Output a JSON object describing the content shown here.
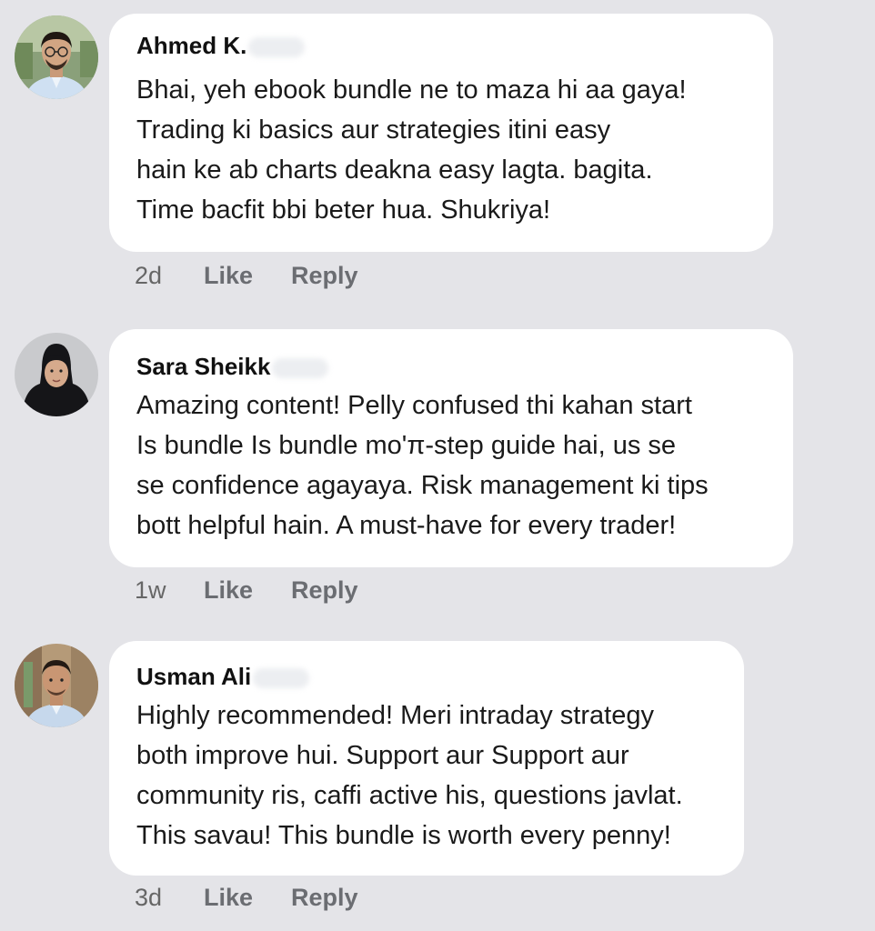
{
  "comments": [
    {
      "author": "Ahmed K.",
      "lines": [
        "Bhai, yeh ebook bundle ne to maza hi aa gaya!",
        "Trading ki basics aur strategies  itini easy",
        "hain ke ab charts deakna easy lagta.  bagita.",
        "Time bacfit bbi beter hua. Shukriya!"
      ],
      "time": "2d",
      "like": "Like",
      "reply": "Reply"
    },
    {
      "author": "Sara Sheikk",
      "lines": [
        "Amazing content! Pelly confused thi kahan start",
        "Is bundle Is bundle mo'π-step guide hai, us se",
        "se  confidence agayaya. Risk management ki tips",
        "bott helpful hain. A must-have for every trader!"
      ],
      "time": "1w",
      "like": "Like",
      "reply": "Reply"
    },
    {
      "author": "Usman Ali",
      "lines": [
        "Highly recommended! Meri intraday strategy",
        "both improve hui. Support aur Support aur",
        "community ris, caffi active his, questions javlat.",
        "This savau! This bundle is worth every penny!"
      ],
      "time": "3d",
      "like": "Like",
      "reply": "Reply"
    }
  ],
  "colors": {
    "background": "#e4e4e8",
    "bubble": "#ffffff",
    "meta_text": "#6b6d72"
  },
  "icons": [
    "avatar-man-glasses",
    "avatar-woman-hijab",
    "avatar-man"
  ]
}
